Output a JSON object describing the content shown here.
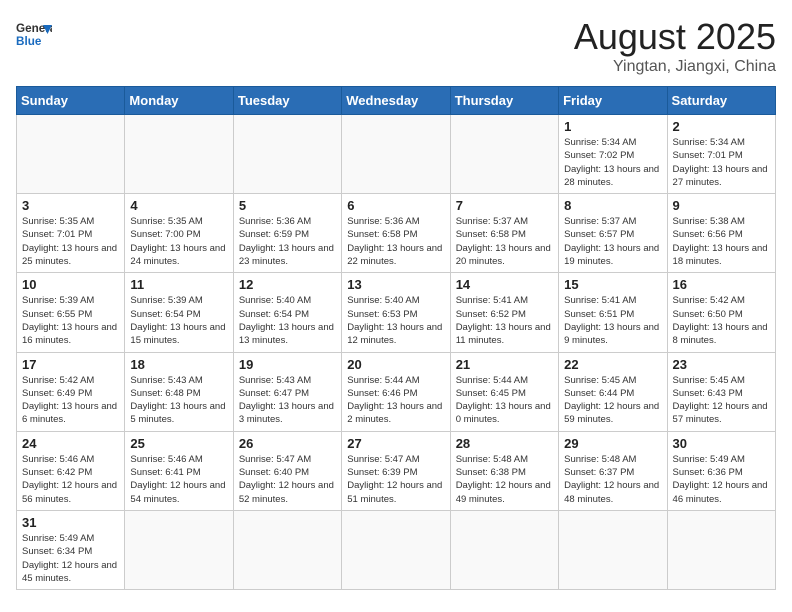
{
  "header": {
    "logo_general": "General",
    "logo_blue": "Blue",
    "title": "August 2025",
    "subtitle": "Yingtan, Jiangxi, China"
  },
  "days_of_week": [
    "Sunday",
    "Monday",
    "Tuesday",
    "Wednesday",
    "Thursday",
    "Friday",
    "Saturday"
  ],
  "weeks": [
    [
      {
        "day": "",
        "info": ""
      },
      {
        "day": "",
        "info": ""
      },
      {
        "day": "",
        "info": ""
      },
      {
        "day": "",
        "info": ""
      },
      {
        "day": "",
        "info": ""
      },
      {
        "day": "1",
        "info": "Sunrise: 5:34 AM\nSunset: 7:02 PM\nDaylight: 13 hours and 28 minutes."
      },
      {
        "day": "2",
        "info": "Sunrise: 5:34 AM\nSunset: 7:01 PM\nDaylight: 13 hours and 27 minutes."
      }
    ],
    [
      {
        "day": "3",
        "info": "Sunrise: 5:35 AM\nSunset: 7:01 PM\nDaylight: 13 hours and 25 minutes."
      },
      {
        "day": "4",
        "info": "Sunrise: 5:35 AM\nSunset: 7:00 PM\nDaylight: 13 hours and 24 minutes."
      },
      {
        "day": "5",
        "info": "Sunrise: 5:36 AM\nSunset: 6:59 PM\nDaylight: 13 hours and 23 minutes."
      },
      {
        "day": "6",
        "info": "Sunrise: 5:36 AM\nSunset: 6:58 PM\nDaylight: 13 hours and 22 minutes."
      },
      {
        "day": "7",
        "info": "Sunrise: 5:37 AM\nSunset: 6:58 PM\nDaylight: 13 hours and 20 minutes."
      },
      {
        "day": "8",
        "info": "Sunrise: 5:37 AM\nSunset: 6:57 PM\nDaylight: 13 hours and 19 minutes."
      },
      {
        "day": "9",
        "info": "Sunrise: 5:38 AM\nSunset: 6:56 PM\nDaylight: 13 hours and 18 minutes."
      }
    ],
    [
      {
        "day": "10",
        "info": "Sunrise: 5:39 AM\nSunset: 6:55 PM\nDaylight: 13 hours and 16 minutes."
      },
      {
        "day": "11",
        "info": "Sunrise: 5:39 AM\nSunset: 6:54 PM\nDaylight: 13 hours and 15 minutes."
      },
      {
        "day": "12",
        "info": "Sunrise: 5:40 AM\nSunset: 6:54 PM\nDaylight: 13 hours and 13 minutes."
      },
      {
        "day": "13",
        "info": "Sunrise: 5:40 AM\nSunset: 6:53 PM\nDaylight: 13 hours and 12 minutes."
      },
      {
        "day": "14",
        "info": "Sunrise: 5:41 AM\nSunset: 6:52 PM\nDaylight: 13 hours and 11 minutes."
      },
      {
        "day": "15",
        "info": "Sunrise: 5:41 AM\nSunset: 6:51 PM\nDaylight: 13 hours and 9 minutes."
      },
      {
        "day": "16",
        "info": "Sunrise: 5:42 AM\nSunset: 6:50 PM\nDaylight: 13 hours and 8 minutes."
      }
    ],
    [
      {
        "day": "17",
        "info": "Sunrise: 5:42 AM\nSunset: 6:49 PM\nDaylight: 13 hours and 6 minutes."
      },
      {
        "day": "18",
        "info": "Sunrise: 5:43 AM\nSunset: 6:48 PM\nDaylight: 13 hours and 5 minutes."
      },
      {
        "day": "19",
        "info": "Sunrise: 5:43 AM\nSunset: 6:47 PM\nDaylight: 13 hours and 3 minutes."
      },
      {
        "day": "20",
        "info": "Sunrise: 5:44 AM\nSunset: 6:46 PM\nDaylight: 13 hours and 2 minutes."
      },
      {
        "day": "21",
        "info": "Sunrise: 5:44 AM\nSunset: 6:45 PM\nDaylight: 13 hours and 0 minutes."
      },
      {
        "day": "22",
        "info": "Sunrise: 5:45 AM\nSunset: 6:44 PM\nDaylight: 12 hours and 59 minutes."
      },
      {
        "day": "23",
        "info": "Sunrise: 5:45 AM\nSunset: 6:43 PM\nDaylight: 12 hours and 57 minutes."
      }
    ],
    [
      {
        "day": "24",
        "info": "Sunrise: 5:46 AM\nSunset: 6:42 PM\nDaylight: 12 hours and 56 minutes."
      },
      {
        "day": "25",
        "info": "Sunrise: 5:46 AM\nSunset: 6:41 PM\nDaylight: 12 hours and 54 minutes."
      },
      {
        "day": "26",
        "info": "Sunrise: 5:47 AM\nSunset: 6:40 PM\nDaylight: 12 hours and 52 minutes."
      },
      {
        "day": "27",
        "info": "Sunrise: 5:47 AM\nSunset: 6:39 PM\nDaylight: 12 hours and 51 minutes."
      },
      {
        "day": "28",
        "info": "Sunrise: 5:48 AM\nSunset: 6:38 PM\nDaylight: 12 hours and 49 minutes."
      },
      {
        "day": "29",
        "info": "Sunrise: 5:48 AM\nSunset: 6:37 PM\nDaylight: 12 hours and 48 minutes."
      },
      {
        "day": "30",
        "info": "Sunrise: 5:49 AM\nSunset: 6:36 PM\nDaylight: 12 hours and 46 minutes."
      }
    ],
    [
      {
        "day": "31",
        "info": "Sunrise: 5:49 AM\nSunset: 6:34 PM\nDaylight: 12 hours and 45 minutes."
      },
      {
        "day": "",
        "info": ""
      },
      {
        "day": "",
        "info": ""
      },
      {
        "day": "",
        "info": ""
      },
      {
        "day": "",
        "info": ""
      },
      {
        "day": "",
        "info": ""
      },
      {
        "day": "",
        "info": ""
      }
    ]
  ]
}
